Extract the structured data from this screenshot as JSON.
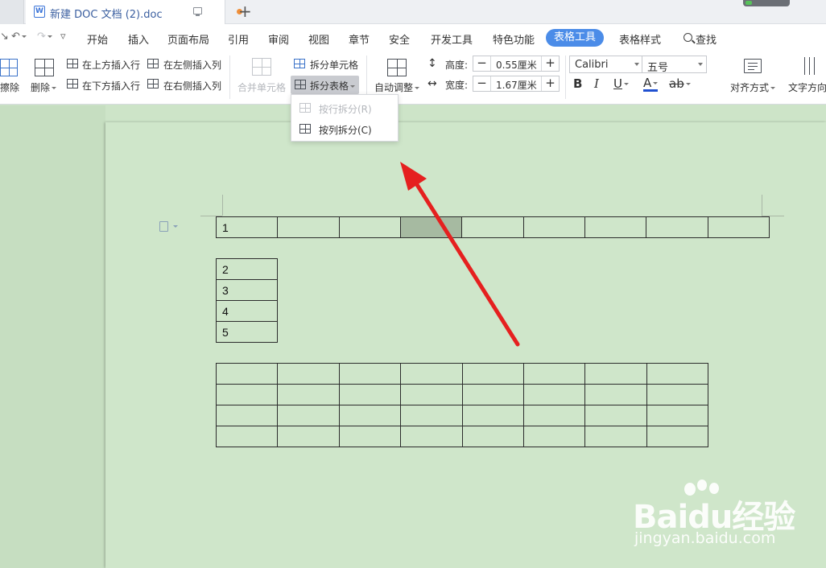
{
  "titlebar": {
    "doc_tab_title": "新建 DOC 文档 (2).doc",
    "doc_icon_letter": "W",
    "new_tab_symbol": "+",
    "unsaved_dot_color": "#ef8f3a"
  },
  "menu": {
    "items": [
      "开始",
      "插入",
      "页面布局",
      "引用",
      "审阅",
      "视图",
      "章节",
      "安全",
      "开发工具",
      "特色功能",
      "表格工具",
      "表格样式"
    ],
    "active": "表格工具",
    "search_label": "查找",
    "accent_color": "#4b8ce8"
  },
  "ribbon": {
    "erase_label": "擦除",
    "delete_label": "删除",
    "insert_row_above": "在上方插入行",
    "insert_row_below": "在下方插入行",
    "insert_col_left": "在左侧插入列",
    "insert_col_right": "在右侧插入列",
    "merge_cells": "合并单元格",
    "split_cells": "拆分单元格",
    "split_table": "拆分表格",
    "auto_fit": "自动调整",
    "height_label": "高度:",
    "height_value": "0.55厘米",
    "width_label": "宽度:",
    "width_value": "1.67厘米",
    "font_name": "Calibri",
    "font_size": "五号",
    "bold": "B",
    "italic": "I",
    "underline": "U",
    "font_color": "A",
    "highlight": "ab",
    "align_label": "对齐方式",
    "text_direction_label": "文字方向"
  },
  "dropdown": {
    "items": [
      {
        "label": "按行拆分(R)",
        "enabled": false
      },
      {
        "label": "按列拆分(C)",
        "enabled": true
      }
    ]
  },
  "document": {
    "table1": {
      "cells": [
        "1",
        "",
        "",
        "",
        "",
        "",
        "",
        "",
        ""
      ],
      "selected_col": 3
    },
    "table2": {
      "cells": [
        "2",
        "3",
        "4",
        "5"
      ]
    },
    "table3": {
      "rows": 4,
      "cols": 8
    }
  },
  "watermark": {
    "brand": "Baidu经验",
    "sub": "jingyan.baidu.com"
  },
  "colors": {
    "page_bg": "#cfe6ca",
    "arrow": "#e5201f",
    "selected_cell": "#a6baa1"
  }
}
